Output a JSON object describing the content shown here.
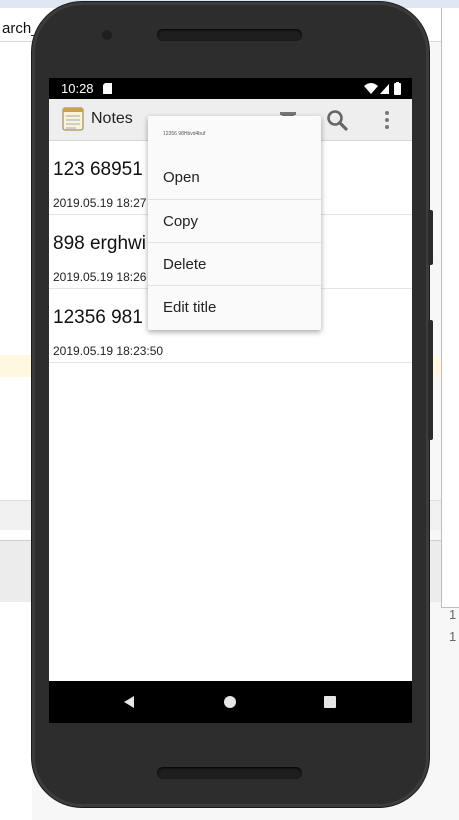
{
  "desktop": {
    "editor_tab_text": "arch_l",
    "line_numbers": [
      "1",
      "1"
    ]
  },
  "status_bar": {
    "time": "10:28"
  },
  "action_bar": {
    "title": "Notes",
    "icons": [
      "notes-app-icon",
      "search-icon",
      "overflow-menu-icon"
    ]
  },
  "notes": [
    {
      "title": "123 68951",
      "date": "2019.05.19 18:27"
    },
    {
      "title": "898 erghwi",
      "date": "2019.05.19 18:26"
    },
    {
      "title": "12356 981",
      "date": "2019.05.19 18:23:50"
    }
  ],
  "context_menu": {
    "header": "12356 98Hbvd4buf",
    "items": [
      {
        "label": "Open"
      },
      {
        "label": "Copy"
      },
      {
        "label": "Delete"
      },
      {
        "label": "Edit title"
      }
    ]
  },
  "nav_bar": {
    "icons": [
      "back-icon",
      "home-icon",
      "recent-apps-icon"
    ]
  },
  "colors": {
    "phone_body": "#2d2d2d",
    "action_bar": "#eeeeee",
    "status_bar": "#000000",
    "menu_bg": "#fafafa"
  }
}
